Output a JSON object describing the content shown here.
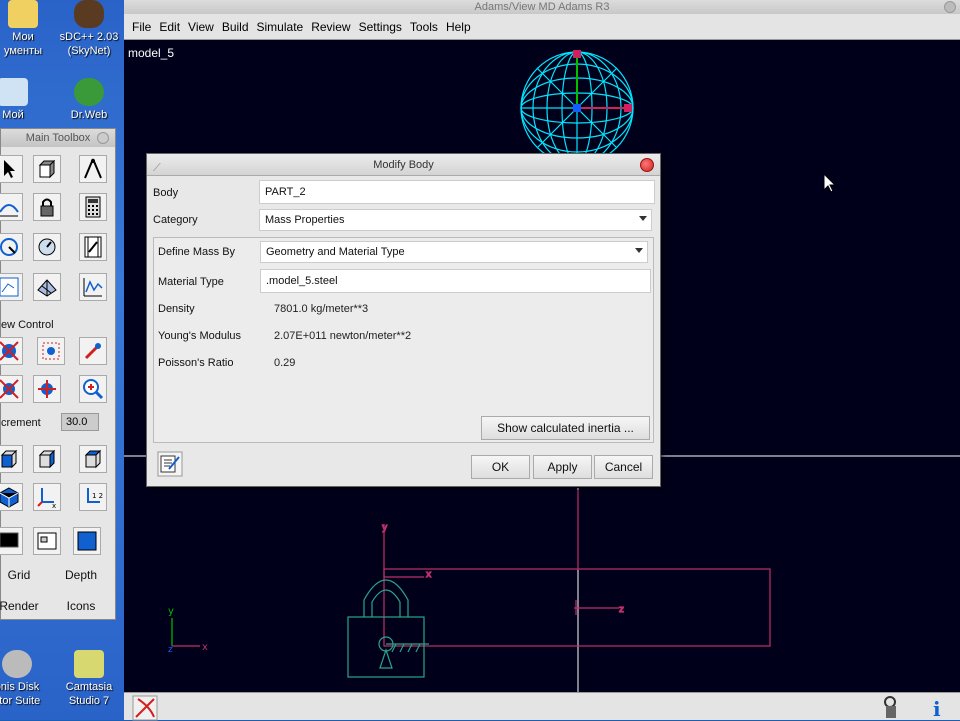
{
  "desktop": {
    "icons": [
      {
        "label": "Мои\nументы"
      },
      {
        "label": "sDC++ 2.03\n(SkyNet)"
      },
      {
        "label": "Мой"
      },
      {
        "label": "Dr.Web"
      },
      {
        "label": "onis Disk\nctor Suite"
      },
      {
        "label": "Camtasia\nStudio 7"
      }
    ]
  },
  "toolbox": {
    "title": "Main Toolbox",
    "view_control_label": "ew Control",
    "increment_label": "crement",
    "increment_value": "30.0",
    "grid_label": "Grid",
    "depth_label": "Depth",
    "render_label": "Render",
    "icons_label": "Icons"
  },
  "app": {
    "title": "Adams/View MD Adams R3",
    "menu": [
      "File",
      "Edit",
      "View",
      "Build",
      "Simulate",
      "Review",
      "Settings",
      "Tools",
      "Help"
    ],
    "model_name": "model_5"
  },
  "dialog": {
    "title": "Modify Body",
    "body_label": "Body",
    "body_value": "PART_2",
    "category_label": "Category",
    "category_value": "Mass Properties",
    "define_mass_label": "Define Mass By",
    "define_mass_value": "Geometry and Material Type",
    "material_type_label": "Material Type",
    "material_type_value": ".model_5.steel",
    "density_label": "Density",
    "density_value": "7801.0 kg/meter**3",
    "youngs_label": "Young's Modulus",
    "youngs_value": "2.07E+011 newton/meter**2",
    "poisson_label": "Poisson's Ratio",
    "poisson_value": "0.29",
    "show_inertia_button": "Show calculated inertia ...",
    "ok_button": "OK",
    "apply_button": "Apply",
    "cancel_button": "Cancel"
  },
  "colors": {
    "sphere": "#00e5ff",
    "wire": "#c0306a",
    "axis_green": "#00c000",
    "lock": "#2aa58a"
  }
}
